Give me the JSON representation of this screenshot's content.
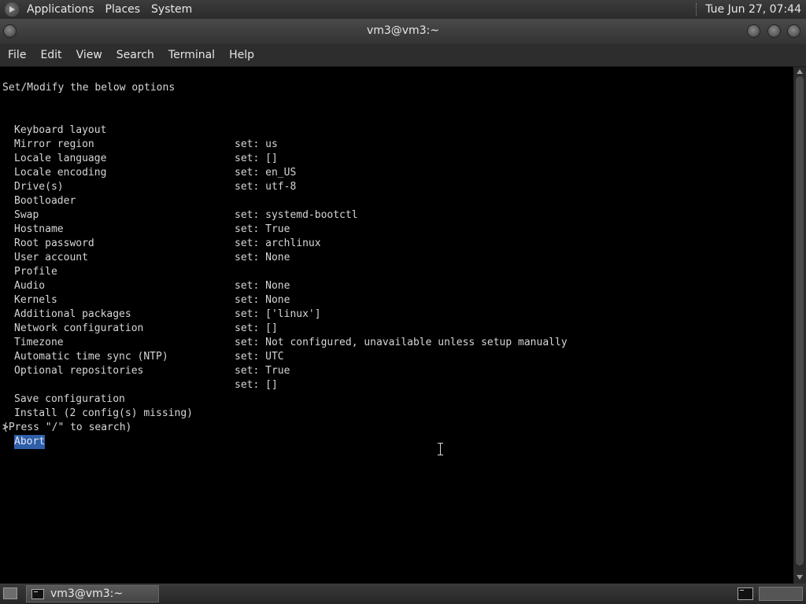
{
  "top_panel": {
    "menus": [
      "Applications",
      "Places",
      "System"
    ],
    "clock": "Tue Jun 27, 07:44",
    "icons": [
      "distro-menu-icon",
      "terminal-icon"
    ]
  },
  "window": {
    "title": "vm3@vm3:~",
    "menubar": [
      "File",
      "Edit",
      "View",
      "Search",
      "Terminal",
      "Help"
    ]
  },
  "terminal": {
    "header": "Set/Modify the below options",
    "options": [
      {
        "name": "Keyboard layout",
        "value": "set: us"
      },
      {
        "name": "Mirror region",
        "value": "set: []"
      },
      {
        "name": "Locale language",
        "value": "set: en_US"
      },
      {
        "name": "Locale encoding",
        "value": "set: utf-8"
      },
      {
        "name": "Drive(s)",
        "value": ""
      },
      {
        "name": "Bootloader",
        "value": "set: systemd-bootctl"
      },
      {
        "name": "Swap",
        "value": "set: True"
      },
      {
        "name": "Hostname",
        "value": "set: archlinux"
      },
      {
        "name": "Root password",
        "value": "set: None"
      },
      {
        "name": "User account",
        "value": ""
      },
      {
        "name": "Profile",
        "value": "set: None"
      },
      {
        "name": "Audio",
        "value": "set: None"
      },
      {
        "name": "Kernels",
        "value": "set: ['linux']"
      },
      {
        "name": "Additional packages",
        "value": "set: []"
      },
      {
        "name": "Network configuration",
        "value": "set: Not configured, unavailable unless setup manually"
      },
      {
        "name": "Timezone",
        "value": "set: UTC"
      },
      {
        "name": "Automatic time sync (NTP)",
        "value": "set: True"
      },
      {
        "name": "Optional repositories",
        "value": "set: []"
      }
    ],
    "actions": [
      "Save configuration",
      "Install (2 config(s) missing)"
    ],
    "cursor_marker": ">",
    "selected_action": "Abort",
    "hint": "(Press \"/\" to search)",
    "selection_color": "#2f5fa8"
  },
  "taskbar": {
    "task_label": "vm3@vm3:~"
  }
}
